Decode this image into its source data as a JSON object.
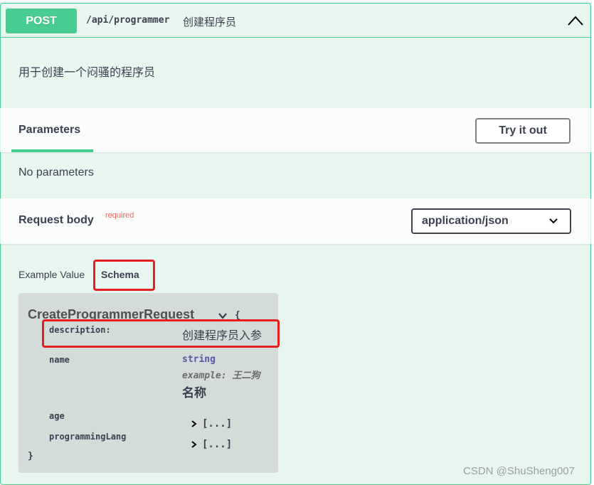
{
  "operation": {
    "method": "POST",
    "path": "/api/programmer",
    "summary": "创建程序员",
    "description": "用于创建一个闷骚的程序员"
  },
  "parameters": {
    "tab_label": "Parameters",
    "try_button": "Try it out",
    "empty_text": "No parameters"
  },
  "request_body": {
    "title": "Request body",
    "required_label": "required",
    "content_type": "application/json"
  },
  "example_tabs": {
    "example_value": "Example Value",
    "schema": "Schema"
  },
  "schema": {
    "model_name": "CreateProgrammerRequest",
    "brace_open": "{",
    "brace_close": "}",
    "description_key": "description:",
    "description_value": "创建程序员入参",
    "props": {
      "name": {
        "key": "name",
        "type": "string",
        "example_label": "example:",
        "example_value": "王二狗",
        "description": "名称"
      },
      "age": {
        "key": "age",
        "collapsed": "[...]"
      },
      "programmingLang": {
        "key": "programmingLang",
        "collapsed": "[...]"
      }
    }
  },
  "watermark": "CSDN @ShuSheng007",
  "colors": {
    "post_green": "#49cc90",
    "block_bg": "#e8f6f0",
    "highlight_red": "#e51f1f",
    "required_red": "#ff6060",
    "model_bg": "#d4dcd9"
  }
}
